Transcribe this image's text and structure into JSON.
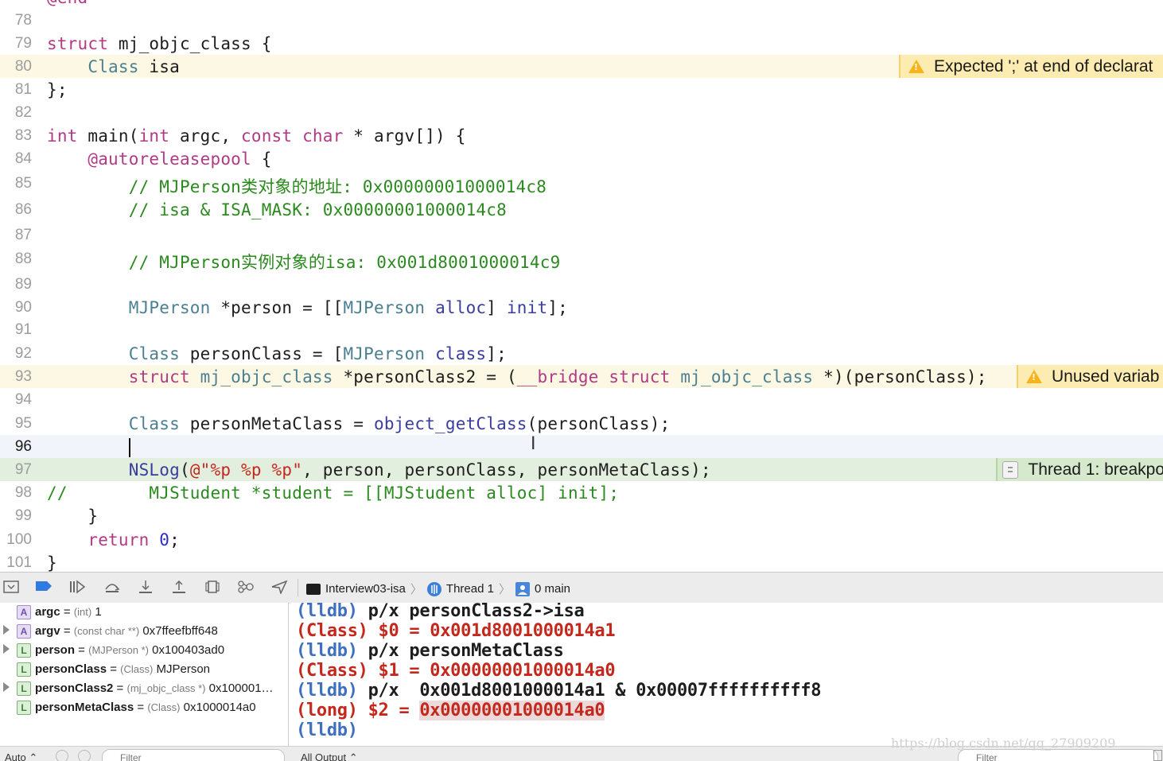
{
  "editor": {
    "lines": [
      {
        "num": "78",
        "text": ""
      },
      {
        "num": "79",
        "text": "struct mj_objc_class {"
      },
      {
        "num": "80",
        "text": "    Class isa"
      },
      {
        "num": "81",
        "text": "};"
      },
      {
        "num": "82",
        "text": ""
      },
      {
        "num": "83",
        "text": "int main(int argc, const char * argv[]) {"
      },
      {
        "num": "84",
        "text": "    @autoreleasepool {"
      },
      {
        "num": "85",
        "text": "        // MJPerson类对象的地址: 0x00000001000014c8"
      },
      {
        "num": "86",
        "text": "        // isa & ISA_MASK: 0x00000001000014c8"
      },
      {
        "num": "87",
        "text": ""
      },
      {
        "num": "88",
        "text": "        // MJPerson实例对象的isa: 0x001d8001000014c9"
      },
      {
        "num": "89",
        "text": ""
      },
      {
        "num": "90",
        "text": "        MJPerson *person = [[MJPerson alloc] init];"
      },
      {
        "num": "91",
        "text": ""
      },
      {
        "num": "92",
        "text": "        Class personClass = [MJPerson class];"
      },
      {
        "num": "93",
        "text": "        struct mj_objc_class *personClass2 = (__bridge struct mj_objc_class *)(personClass);"
      },
      {
        "num": "94",
        "text": ""
      },
      {
        "num": "95",
        "text": "        Class personMetaClass = object_getClass(personClass);"
      },
      {
        "num": "96",
        "text": ""
      },
      {
        "num": "97",
        "text": "        NSLog(@\"%p %p %p\", person, personClass, personMetaClass);"
      },
      {
        "num": "98",
        "text": "//        MJStudent *student = [[MJStudent alloc] init];"
      },
      {
        "num": "99",
        "text": "    }"
      },
      {
        "num": "100",
        "text": "    return 0;"
      },
      {
        "num": "101",
        "text": "}"
      }
    ],
    "issues": {
      "line80": "Expected ';' at end of declarat",
      "line93": "Unused variab",
      "line97": "Thread 1: breakpo"
    }
  },
  "debug_bar": {
    "icons": [
      "hide-debug-area-icon",
      "breakpoints-toggle-icon",
      "continue-icon",
      "step-over-icon",
      "step-into-icon",
      "step-out-icon",
      "view-hierarchy-icon",
      "memory-graph-icon",
      "simulate-location-icon"
    ],
    "jump": {
      "target": "Interview03-isa",
      "thread": "Thread 1",
      "frame": "0 main"
    }
  },
  "variables": [
    {
      "badge": "A",
      "name": "argc",
      "type": "(int)",
      "value": "1"
    },
    {
      "badge": "A",
      "name": "argv",
      "type": "(const char **)",
      "value": "0x7ffeefbff648"
    },
    {
      "badge": "L",
      "name": "person",
      "type": "(MJPerson *)",
      "value": "0x100403ad0"
    },
    {
      "badge": "L",
      "name": "personClass",
      "type": "(Class)",
      "value": "MJPerson"
    },
    {
      "badge": "L",
      "name": "personClass2",
      "type": "(mj_objc_class *)",
      "value": "0x100001…"
    },
    {
      "badge": "L",
      "name": "personMetaClass",
      "type": "(Class)",
      "value": "0x1000014a0"
    }
  ],
  "console": {
    "lines": [
      {
        "prompt": "(lldb)",
        "cmd": " p/x personClass2->isa"
      },
      {
        "prefix": "(Class) $0 = ",
        "value": "0x001d8001000014a1"
      },
      {
        "prompt": "(lldb)",
        "cmd": " p/x personMetaClass"
      },
      {
        "prefix": "(Class) $1 = ",
        "value": "0x00000001000014a0"
      },
      {
        "prompt": "(lldb)",
        "cmd": " p/x  0x001d8001000014a1 & 0x00007ffffffffff8"
      },
      {
        "prefix": "(long) $2 = ",
        "value": "0x00000001000014a0"
      },
      {
        "prompt": "(lldb)",
        "cmd": ""
      }
    ]
  },
  "bottom_bar": {
    "auto_label": "Auto ⌃",
    "var_filter_placeholder": "Filter",
    "output_label": "All Output ⌃",
    "console_filter_placeholder": "Filter"
  },
  "watermark": "https://blog.csdn.net/qq_27909209"
}
